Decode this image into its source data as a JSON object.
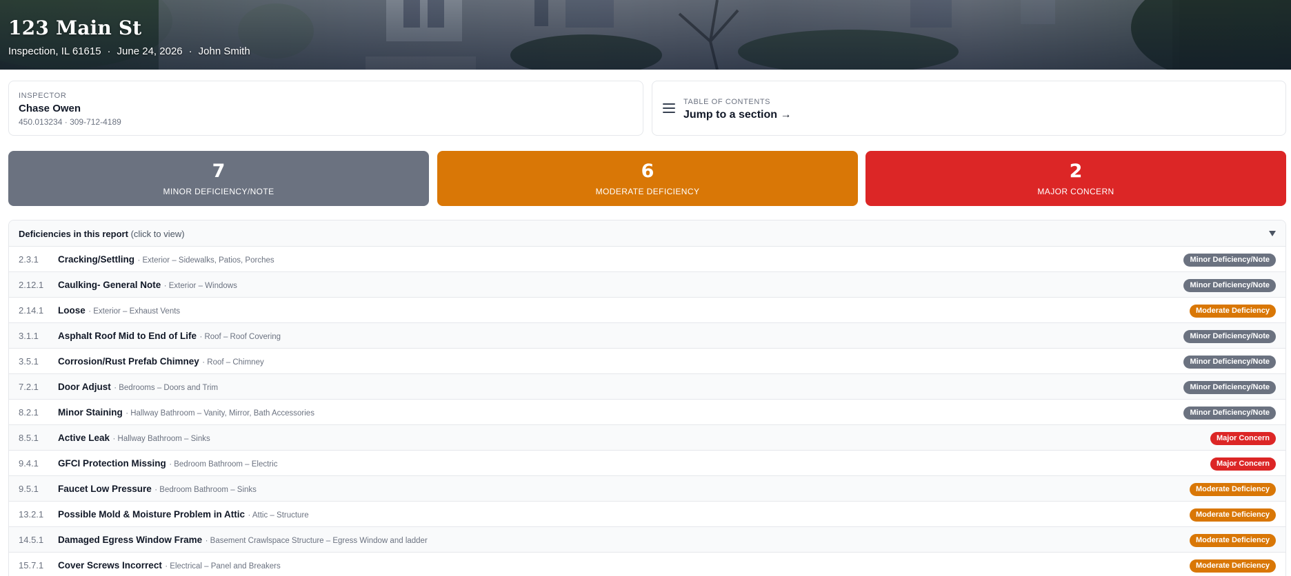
{
  "hero": {
    "title": "123 Main St",
    "location": "Inspection, IL 61615",
    "date": "June 24, 2026",
    "client": "John Smith",
    "separator": "·"
  },
  "inspector": {
    "eyebrow": "INSPECTOR",
    "name": "Chase Owen",
    "contact": "450.013234 · 309-712-4189"
  },
  "toc": {
    "eyebrow": "TABLE OF CONTENTS",
    "link": "Jump to a section →",
    "icon": "menu-icon"
  },
  "summary": [
    {
      "count": "7",
      "label": "MINOR DEFICIENCY/NOTE",
      "color": "#6b7280"
    },
    {
      "count": "6",
      "label": "MODERATE DEFICIENCY",
      "color": "#d97706"
    },
    {
      "count": "2",
      "label": "MAJOR CONCERN",
      "color": "#dc2626"
    }
  ],
  "deficiencies": {
    "title": "Deficiencies in this report",
    "hint": "(click to view)",
    "rows": [
      {
        "num": "2.3.1",
        "title": "Cracking/Settling",
        "location": "· Exterior – Sidewalks, Patios, Porches",
        "severity": "Minor Deficiency/Note",
        "level": "minor"
      },
      {
        "num": "2.12.1",
        "title": "Caulking- General Note",
        "location": "· Exterior – Windows",
        "severity": "Minor Deficiency/Note",
        "level": "minor"
      },
      {
        "num": "2.14.1",
        "title": "Loose",
        "location": "· Exterior – Exhaust Vents",
        "severity": "Moderate Deficiency",
        "level": "moderate"
      },
      {
        "num": "3.1.1",
        "title": "Asphalt Roof Mid to End of Life",
        "location": "· Roof – Roof Covering",
        "severity": "Minor Deficiency/Note",
        "level": "minor"
      },
      {
        "num": "3.5.1",
        "title": "Corrosion/Rust Prefab Chimney",
        "location": "· Roof – Chimney",
        "severity": "Minor Deficiency/Note",
        "level": "minor"
      },
      {
        "num": "7.2.1",
        "title": "Door Adjust",
        "location": "· Bedrooms – Doors and Trim",
        "severity": "Minor Deficiency/Note",
        "level": "minor"
      },
      {
        "num": "8.2.1",
        "title": "Minor Staining",
        "location": "· Hallway Bathroom – Vanity, Mirror, Bath Accessories",
        "severity": "Minor Deficiency/Note",
        "level": "minor"
      },
      {
        "num": "8.5.1",
        "title": "Active Leak",
        "location": "· Hallway Bathroom – Sinks",
        "severity": "Major Concern",
        "level": "major"
      },
      {
        "num": "9.4.1",
        "title": "GFCI Protection Missing",
        "location": "· Bedroom Bathroom – Electric",
        "severity": "Major Concern",
        "level": "major"
      },
      {
        "num": "9.5.1",
        "title": "Faucet Low Pressure",
        "location": "· Bedroom Bathroom – Sinks",
        "severity": "Moderate Deficiency",
        "level": "moderate"
      },
      {
        "num": "13.2.1",
        "title": "Possible Mold & Moisture Problem in Attic",
        "location": "· Attic – Structure",
        "severity": "Moderate Deficiency",
        "level": "moderate"
      },
      {
        "num": "14.5.1",
        "title": "Damaged Egress Window Frame",
        "location": "· Basement Crawlspace Structure – Egress Window and ladder",
        "severity": "Moderate Deficiency",
        "level": "moderate"
      },
      {
        "num": "15.7.1",
        "title": "Cover Screws Incorrect",
        "location": "· Electrical – Panel and Breakers",
        "severity": "Moderate Deficiency",
        "level": "moderate"
      }
    ]
  }
}
